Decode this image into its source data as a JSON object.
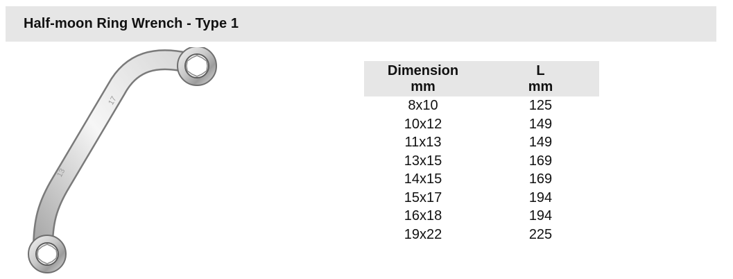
{
  "page": {
    "title": "Half-moon Ring Wrench - Type 1"
  },
  "product_image": {
    "description_icon": "half-moon-ring-wrench",
    "engravings": [
      "17",
      "13"
    ]
  },
  "spec_table": {
    "headers": [
      {
        "line1": "Dimension",
        "line2": "mm"
      },
      {
        "line1": "L",
        "line2": "mm"
      }
    ],
    "rows": [
      {
        "dimension": "8x10",
        "length": "125"
      },
      {
        "dimension": "10x12",
        "length": "149"
      },
      {
        "dimension": "11x13",
        "length": "149"
      },
      {
        "dimension": "13x15",
        "length": "169"
      },
      {
        "dimension": "14x15",
        "length": "169"
      },
      {
        "dimension": "15x17",
        "length": "194"
      },
      {
        "dimension": "16x18",
        "length": "194"
      },
      {
        "dimension": "19x22",
        "length": "225"
      }
    ]
  },
  "colors": {
    "header_background": "#e6e6e6",
    "text": "#111111"
  }
}
